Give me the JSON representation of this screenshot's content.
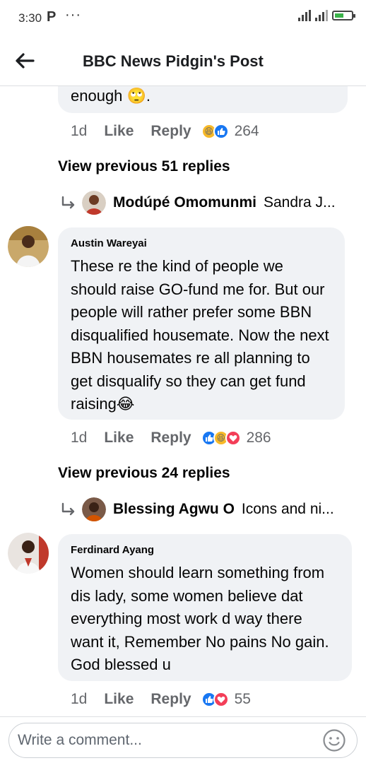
{
  "status_bar": {
    "time": "3:30",
    "p_icon": "P",
    "dots": "···"
  },
  "header": {
    "title": "BBC News Pidgin's Post"
  },
  "comments": [
    {
      "text_tail": "enough 🙄.",
      "time": "1d",
      "like": "Like",
      "reply": "Reply",
      "reactions": [
        "haha",
        "like"
      ],
      "count": "264"
    },
    {
      "author": "Austin Wareyai",
      "text": "These re the kind of people we should raise GO-fund me for. But our people will rather prefer some BBN disqualified housemate. Now the next BBN housemates re all planning to get disqualify so they can get fund raising😂",
      "time": "1d",
      "like": "Like",
      "reply": "Reply",
      "reactions": [
        "like",
        "haha",
        "love"
      ],
      "count": "286"
    },
    {
      "author": "Ferdinard Ayang",
      "text": "Women should learn something from dis lady, some women believe dat everything most work d way there want it, Remember No pains No gain. God blessed u",
      "time": "1d",
      "like": "Like",
      "reply": "Reply",
      "reactions": [
        "like",
        "love"
      ],
      "count": "55"
    }
  ],
  "view_previous": [
    "View previous 51 replies",
    "View previous 24 replies"
  ],
  "reply_previews": [
    {
      "name": "Modúpé Omomunmi",
      "text": "Sandra J..."
    },
    {
      "name": "Blessing Agwu O",
      "text": "Icons and ni..."
    }
  ],
  "composer": {
    "placeholder": "Write a comment..."
  },
  "colors": {
    "bubble_bg": "#f0f2f5",
    "meta_text": "#65676b",
    "like_blue": "#1877f2",
    "haha_yellow": "#f7b928",
    "love_red": "#f33e58"
  },
  "icons": [
    "back-arrow-icon",
    "reply-arrow-icon",
    "emoji-icon",
    "signal-icon",
    "battery-icon"
  ]
}
